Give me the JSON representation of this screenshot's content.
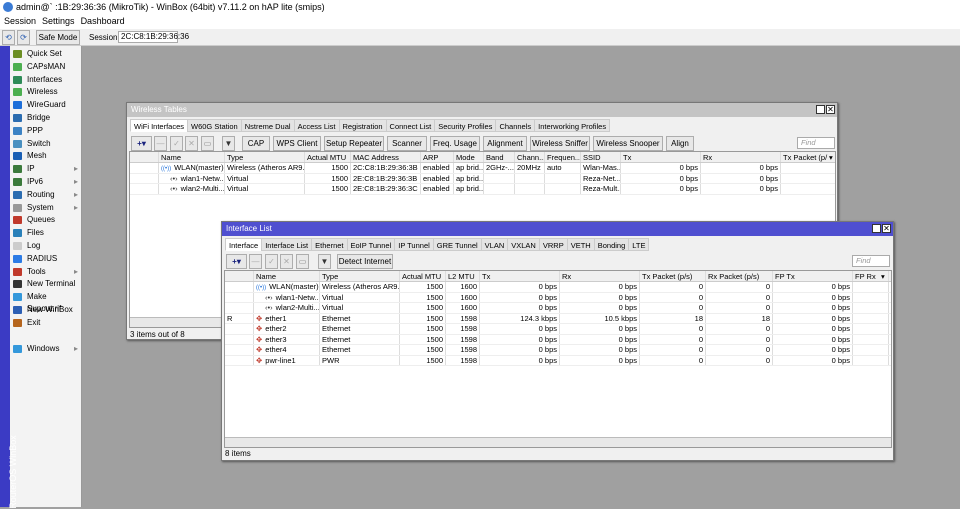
{
  "app": {
    "title": "admin@`      :1B:29:36:36 (MikroTik) - WinBox (64bit) v7.11.2 on hAP lite (smips)",
    "brand_strip": "RouterOS WinBox"
  },
  "menu": [
    "Session",
    "Settings",
    "Dashboard"
  ],
  "toolbar": {
    "undo": "⟲",
    "redo": "⟳",
    "safe_mode": "Safe Mode",
    "session_label": "Session:",
    "session_value": "2C:C8:1B:29:36:36"
  },
  "sidebar": [
    {
      "label": "Quick Set",
      "icon": "quick-set-icon",
      "color": "#6b8e23"
    },
    {
      "label": "CAPsMAN",
      "icon": "antenna-icon",
      "color": "#4caf50"
    },
    {
      "label": "Interfaces",
      "icon": "interfaces-icon",
      "color": "#2e8b57"
    },
    {
      "label": "Wireless",
      "icon": "antenna-icon",
      "color": "#4caf50"
    },
    {
      "label": "WireGuard",
      "icon": "wireguard-icon",
      "color": "#1e6fd9"
    },
    {
      "label": "Bridge",
      "icon": "bridge-icon",
      "color": "#2b6cb0"
    },
    {
      "label": "PPP",
      "icon": "ppp-icon",
      "color": "#3b82c4"
    },
    {
      "label": "Switch",
      "icon": "switch-icon",
      "color": "#4a90c0"
    },
    {
      "label": "Mesh",
      "icon": "mesh-icon",
      "color": "#1a5fb4"
    },
    {
      "label": "IP",
      "icon": "ip-icon",
      "color": "#3b7a3b",
      "submenu": true
    },
    {
      "label": "IPv6",
      "icon": "ipv6-icon",
      "color": "#3b7a3b",
      "submenu": true
    },
    {
      "label": "Routing",
      "icon": "routing-icon",
      "color": "#2b6cb0",
      "submenu": true
    },
    {
      "label": "System",
      "icon": "system-icon",
      "color": "#999999",
      "submenu": true
    },
    {
      "label": "Queues",
      "icon": "queues-icon",
      "color": "#c0392b"
    },
    {
      "label": "Files",
      "icon": "files-icon",
      "color": "#2980b9"
    },
    {
      "label": "Log",
      "icon": "log-icon",
      "color": "#cccccc"
    },
    {
      "label": "RADIUS",
      "icon": "radius-icon",
      "color": "#2c7be5"
    },
    {
      "label": "Tools",
      "icon": "tools-icon",
      "color": "#c0392b",
      "submenu": true
    },
    {
      "label": "New Terminal",
      "icon": "terminal-icon",
      "color": "#333333"
    },
    {
      "label": "Make Supout.rif",
      "icon": "supout-icon",
      "color": "#3498db"
    },
    {
      "label": "New WinBox",
      "icon": "winbox-icon",
      "color": "#2c5fb4"
    },
    {
      "label": "Exit",
      "icon": "exit-icon",
      "color": "#b5651d"
    },
    {
      "label": "Windows",
      "icon": "windows-icon",
      "color": "#3498db",
      "submenu": true
    }
  ],
  "wireless": {
    "title": "Wireless Tables",
    "tabs": [
      "WiFi Interfaces",
      "W60G Station",
      "Nstreme Dual",
      "Access List",
      "Registration",
      "Connect List",
      "Security Profiles",
      "Channels",
      "Interworking Profiles"
    ],
    "buttons": [
      "CAP",
      "WPS Client",
      "Setup Repeater",
      "Scanner",
      "Freq. Usage",
      "Alignment",
      "Wireless Sniffer",
      "Wireless Snooper",
      "Align"
    ],
    "find_placeholder": "Find",
    "columns": [
      "",
      "Name",
      "Type",
      "Actual MTU",
      "MAC Address",
      "ARP",
      "Mode",
      "Band",
      "Chann...",
      "Frequen...",
      "SSID",
      "Tx",
      "Rx",
      "Tx Packet (p/"
    ],
    "rows": [
      [
        "",
        "WLAN(master)",
        "Wireless (Atheros AR9...",
        "1500",
        "2C:C8:1B:29:36:3B",
        "enabled",
        "ap brid...",
        "2GHz-...",
        "20MHz",
        "auto",
        "Wlan-Mas...",
        "0 bps",
        "0 bps",
        ""
      ],
      [
        "",
        "wlan1-Netw...",
        "Virtual",
        "1500",
        "2E:C8:1B:29:36:3B",
        "enabled",
        "ap brid...",
        "",
        "",
        "",
        "Reza-Net...",
        "0 bps",
        "0 bps",
        ""
      ],
      [
        "",
        "wlan2-Multi...",
        "Virtual",
        "1500",
        "2E:C8:1B:29:36:3C",
        "enabled",
        "ap brid...",
        "",
        "",
        "",
        "Reza-Mult...",
        "0 bps",
        "0 bps",
        ""
      ]
    ],
    "status": "3 items out of 8"
  },
  "iflist": {
    "title": "Interface List",
    "tabs": [
      "Interface",
      "Interface List",
      "Ethernet",
      "EoIP Tunnel",
      "IP Tunnel",
      "GRE Tunnel",
      "VLAN",
      "VXLAN",
      "VRRP",
      "VETH",
      "Bonding",
      "LTE"
    ],
    "buttons": [
      "Detect Internet"
    ],
    "find_placeholder": "Find",
    "columns": [
      "",
      "Name",
      "Type",
      "Actual MTU",
      "L2 MTU",
      "Tx",
      "Rx",
      "Tx Packet (p/s)",
      "Rx Packet (p/s)",
      "FP Tx",
      "FP Rx"
    ],
    "rows": [
      [
        "",
        "WLAN(master)",
        "Wireless (Atheros AR9...",
        "1500",
        "1600",
        "0 bps",
        "0 bps",
        "0",
        "0",
        "0 bps",
        ""
      ],
      [
        "",
        "wlan1-Netw...",
        "Virtual",
        "1500",
        "1600",
        "0 bps",
        "0 bps",
        "0",
        "0",
        "0 bps",
        ""
      ],
      [
        "",
        "wlan2-Multi...",
        "Virtual",
        "1500",
        "1600",
        "0 bps",
        "0 bps",
        "0",
        "0",
        "0 bps",
        ""
      ],
      [
        "R",
        "ether1",
        "Ethernet",
        "1500",
        "1598",
        "124.3 kbps",
        "10.5 kbps",
        "18",
        "18",
        "0 bps",
        ""
      ],
      [
        "",
        "ether2",
        "Ethernet",
        "1500",
        "1598",
        "0 bps",
        "0 bps",
        "0",
        "0",
        "0 bps",
        ""
      ],
      [
        "",
        "ether3",
        "Ethernet",
        "1500",
        "1598",
        "0 bps",
        "0 bps",
        "0",
        "0",
        "0 bps",
        ""
      ],
      [
        "",
        "ether4",
        "Ethernet",
        "1500",
        "1598",
        "0 bps",
        "0 bps",
        "0",
        "0",
        "0 bps",
        ""
      ],
      [
        "",
        "pwr-line1",
        "PWR",
        "1500",
        "1598",
        "0 bps",
        "0 bps",
        "0",
        "0",
        "0 bps",
        ""
      ]
    ],
    "status": "8 items"
  },
  "colors": {
    "active_title": "#4f4fd0",
    "inactive_title": "#c4c4c4",
    "sidebar_strip": "#3b3bc4",
    "desktop": "#a0a0a0"
  }
}
